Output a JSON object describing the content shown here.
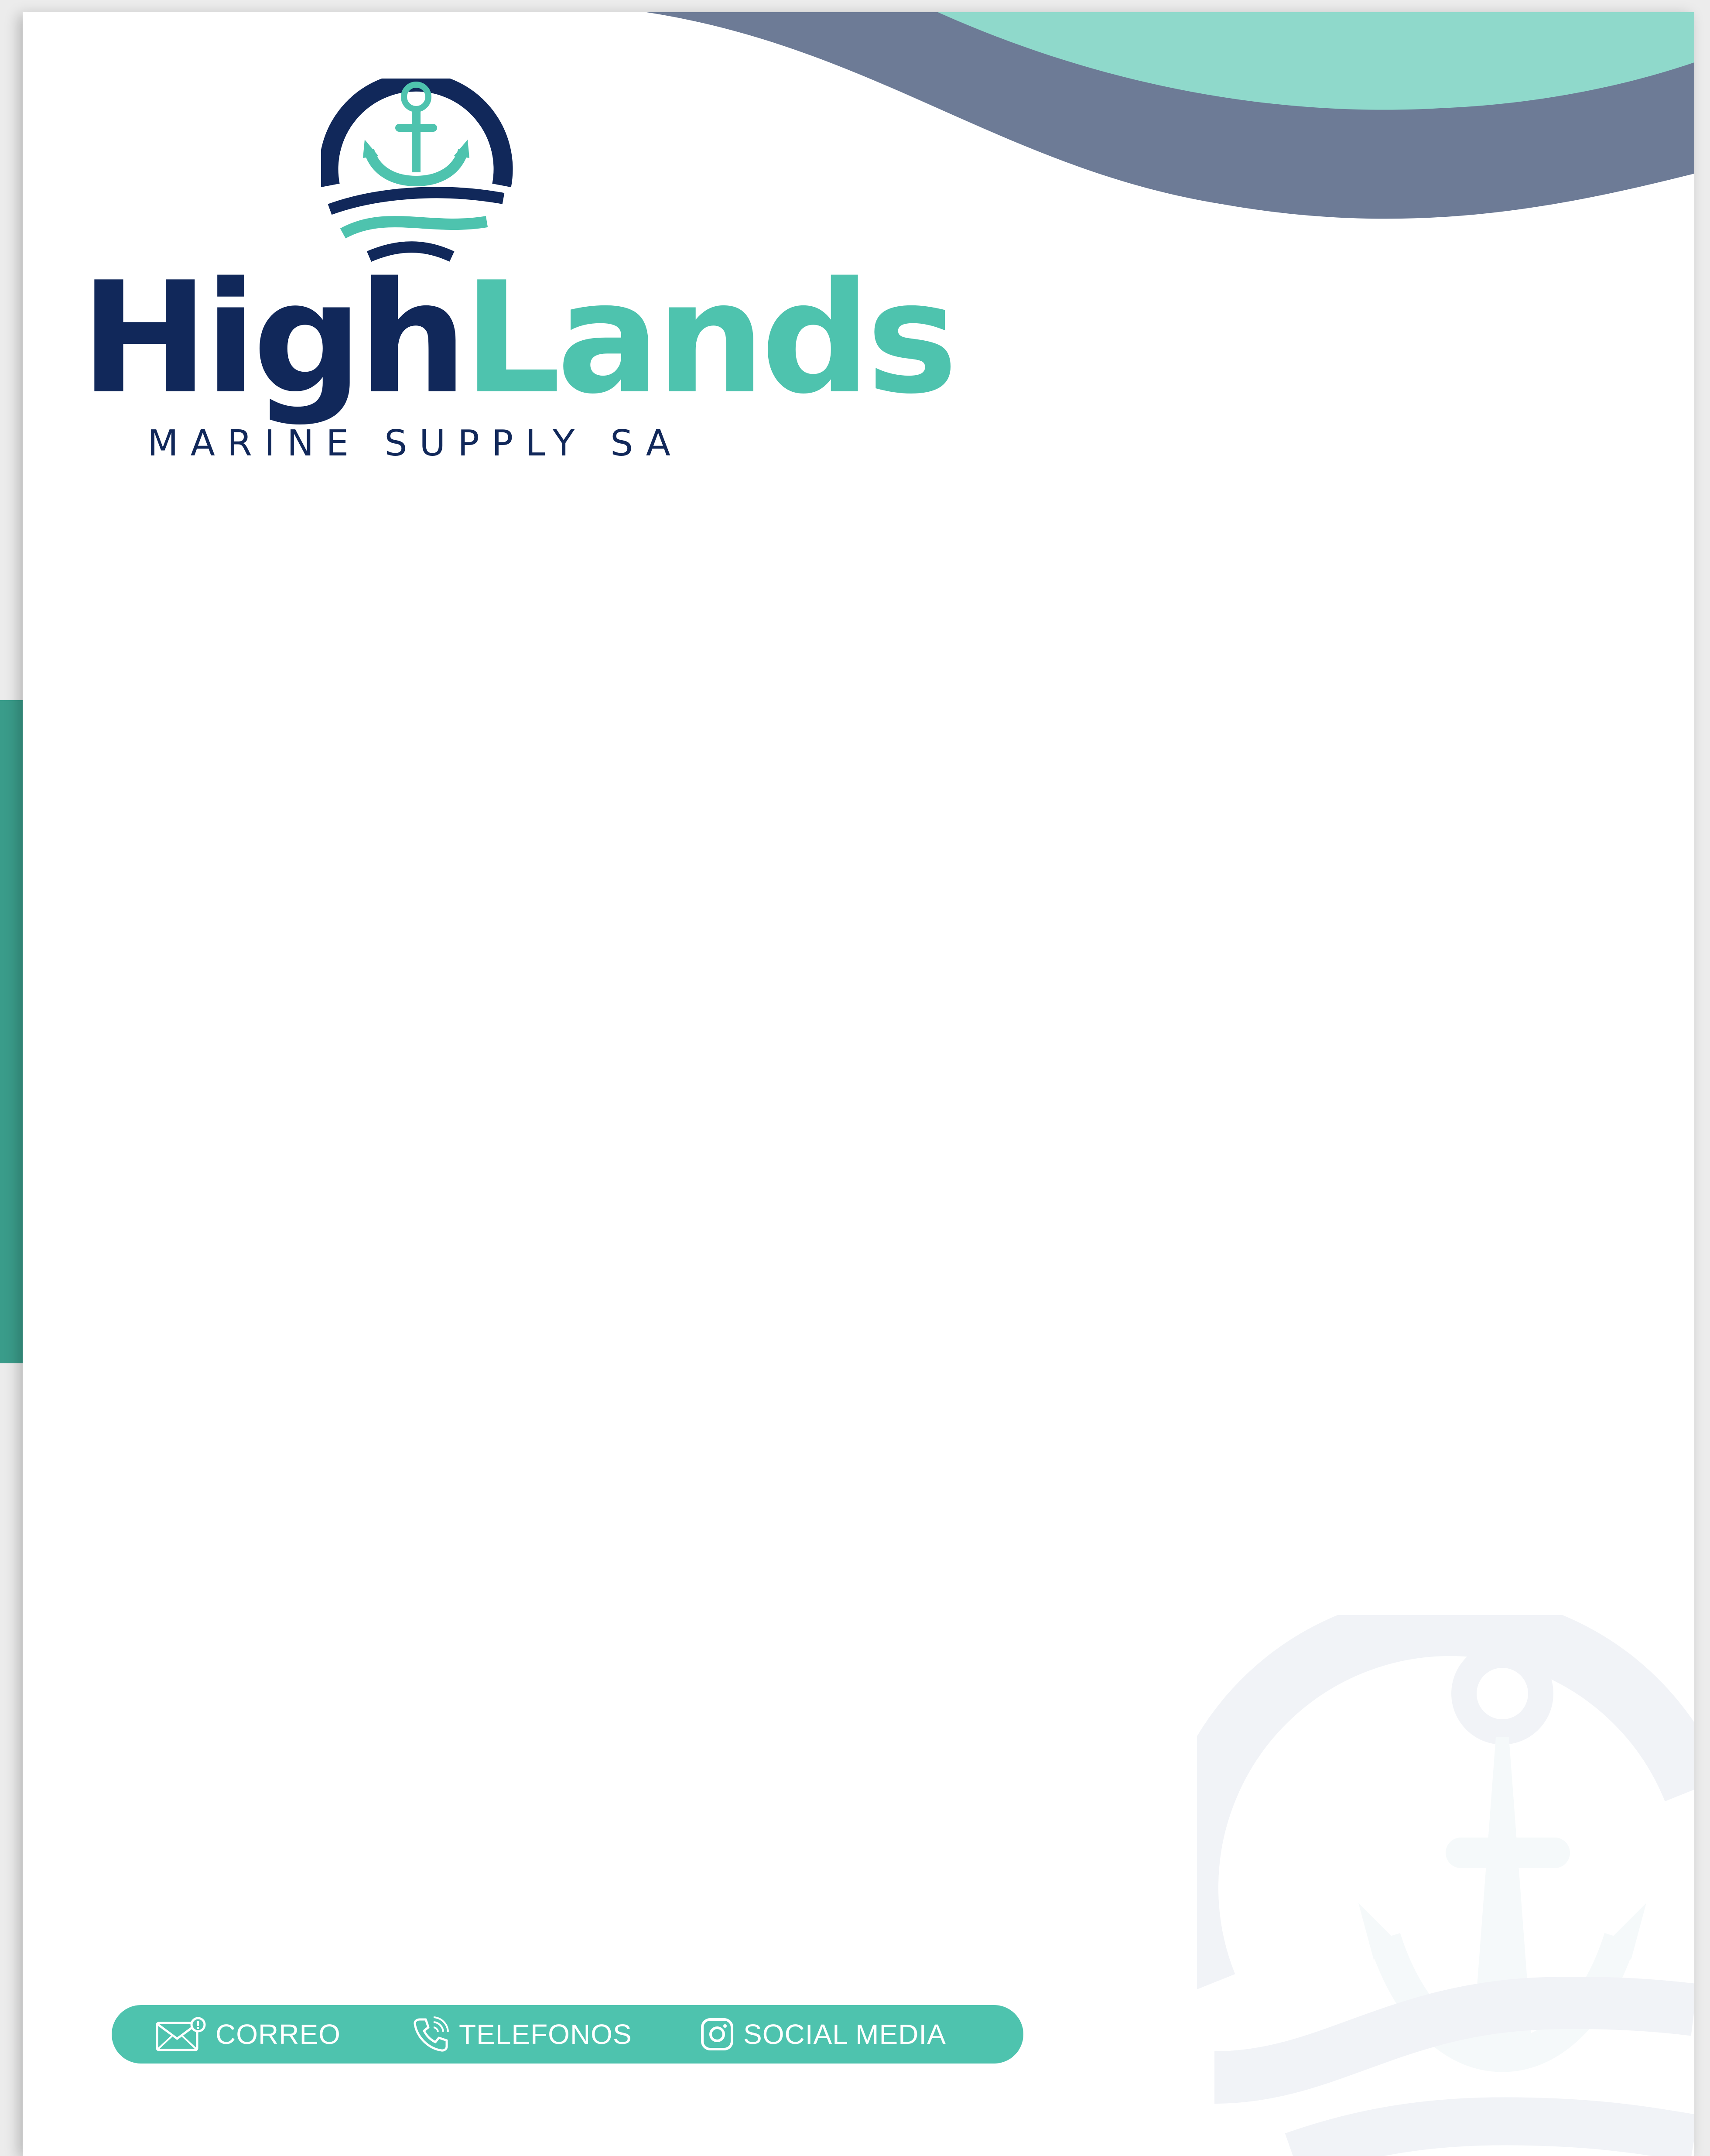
{
  "brand": {
    "name_part1": "High",
    "name_part2": "Lands",
    "tagline": "MARINE SUPPLY SA"
  },
  "footer": {
    "email_label": "CORREO",
    "phone_label": "TELEFONOS",
    "social_label": "SOCIAL MEDIA"
  },
  "icons": {
    "logo": "anchor-waves-icon",
    "email": "envelope-icon",
    "phone": "phone-icon",
    "social": "instagram-icon",
    "watermark": "anchor-watermark-icon"
  },
  "colors": {
    "navy": "#11285a",
    "teal": "#4ec3ae",
    "mint": "#8fd9cb",
    "slate": "#6d7b96",
    "side_tab": "#3a9c8a"
  }
}
